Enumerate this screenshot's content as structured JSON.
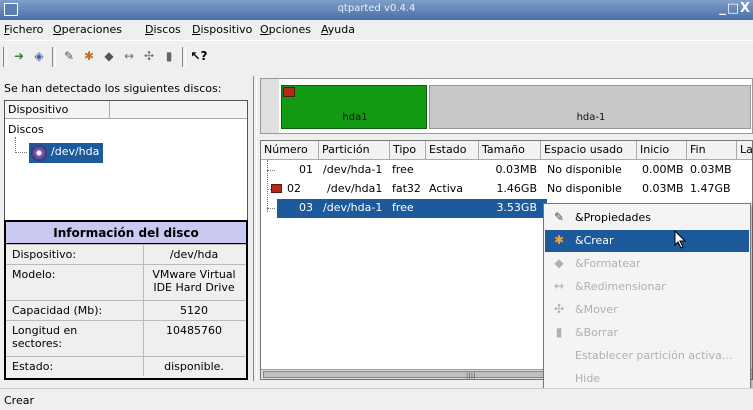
{
  "window": {
    "title": "qtparted v0.4.4",
    "controls": "_□X"
  },
  "menu": [
    {
      "label": "Fichero",
      "key": "F"
    },
    {
      "label": "Operaciones",
      "key": "O"
    },
    {
      "label": "Discos",
      "key": "D"
    },
    {
      "label": "Dispositivo",
      "key": "D"
    },
    {
      "label": "Opciones",
      "key": "O"
    },
    {
      "label": "Ayuda",
      "key": "A"
    }
  ],
  "toolbar": [
    "apply-icon",
    "undo-icon",
    "properties-icon",
    "create-icon",
    "format-icon",
    "resize-icon",
    "move-icon",
    "delete-icon",
    "whats-this-icon"
  ],
  "left": {
    "detect_label": "Se han detectado los siguientes discos:",
    "tree_header": "Dispositivo",
    "group": "Discos",
    "device": "/dev/hda"
  },
  "disk_info": {
    "title": "Información del disco",
    "rows": [
      {
        "k": "Dispositivo:",
        "v": "/dev/hda"
      },
      {
        "k": "Modelo:",
        "v": "VMware Virtual IDE Hard Drive"
      },
      {
        "k": "Capacidad (Mb):",
        "v": "5120"
      },
      {
        "k": "Longitud en sectores:",
        "v": "10485760"
      },
      {
        "k": "Estado:",
        "v": "disponible."
      }
    ]
  },
  "diskmap": {
    "p1": "hda1",
    "p2": "hda-1",
    "p1_color": "#129a12",
    "free_color": "#c8c8c8"
  },
  "table": {
    "headers": [
      "Número",
      "Partición",
      "Tipo",
      "Estado",
      "Tamaño",
      "Espacio usado",
      "Inicio",
      "Fin",
      "La"
    ],
    "rows": [
      {
        "num": "01",
        "part": "/dev/hda-1",
        "tipo": "free",
        "estado": "",
        "tam": "0.03MB",
        "usado": "No disponible",
        "inicio": "0.00MB",
        "fin": "0.03MB"
      },
      {
        "num": "02",
        "part": "/dev/hda1",
        "tipo": "fat32",
        "estado": "Activa",
        "tam": "1.46GB",
        "usado": "No disponible",
        "inicio": "0.03MB",
        "fin": "1.47GB"
      },
      {
        "num": "03",
        "part": "/dev/hda-1",
        "tipo": "free",
        "estado": "",
        "tam": "3.53GB",
        "usado": "",
        "inicio": "",
        "fin": ""
      }
    ]
  },
  "context_menu": [
    {
      "label": "&Propiedades",
      "state": "normal",
      "icon": "wrench-icon"
    },
    {
      "label": "&Crear",
      "state": "highlight",
      "icon": "create-icon"
    },
    {
      "label": "&Formatear",
      "state": "disabled",
      "icon": "eraser-icon"
    },
    {
      "label": "&Redimensionar",
      "state": "disabled",
      "icon": "resize-icon"
    },
    {
      "label": "&Mover",
      "state": "disabled",
      "icon": "move-icon"
    },
    {
      "label": "&Borrar",
      "state": "disabled",
      "icon": "trash-icon"
    },
    {
      "label": "Establecer partición activa...",
      "state": "disabled",
      "icon": ""
    },
    {
      "label": "Hide",
      "state": "disabled",
      "icon": ""
    }
  ],
  "status": "Crear",
  "accent": "#1c5a9b"
}
